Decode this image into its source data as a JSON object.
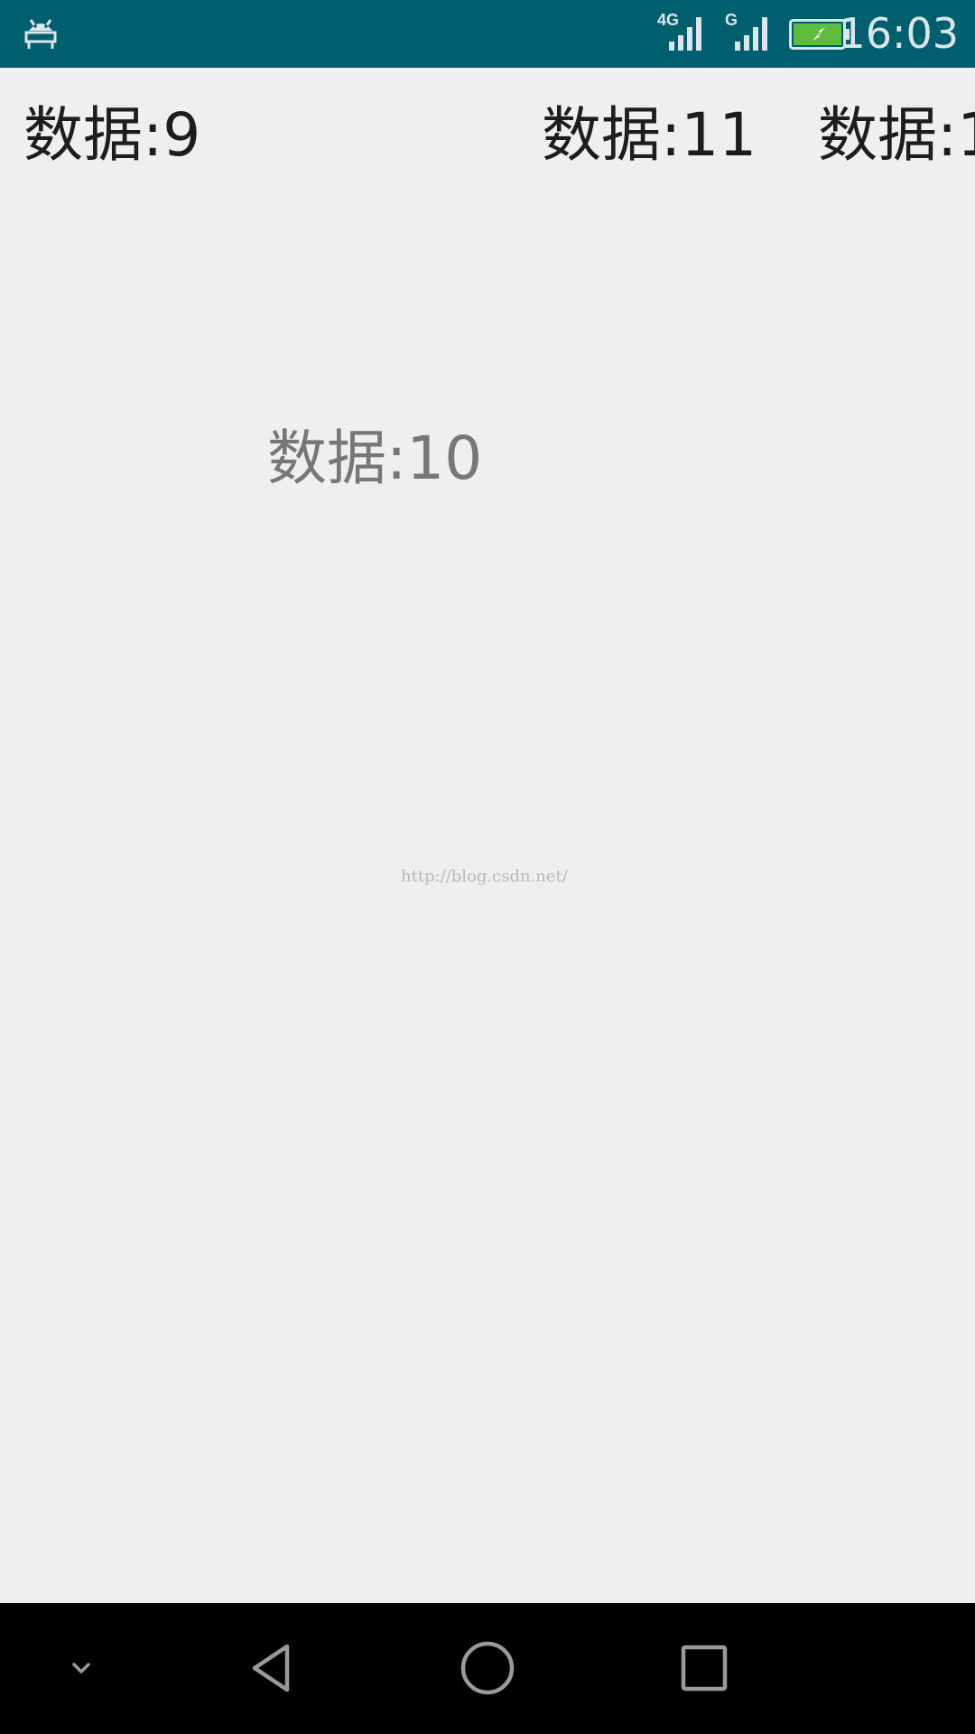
{
  "status_bar": {
    "network_1": "4G",
    "network_2": "G",
    "time": "16:03",
    "battery_icon": "battery-charging-icon",
    "notification_icon": "android-debug-icon",
    "colors": {
      "bar": "#005f6f",
      "battery_fill": "#5ebd3e"
    }
  },
  "carousel": {
    "items": [
      {
        "label": "数据:9"
      },
      {
        "label": "数据:10"
      },
      {
        "label": "数据:11"
      },
      {
        "label": "数据:1"
      }
    ]
  },
  "watermark": "http://blog.csdn.net/",
  "nav_bar": {
    "buttons": [
      {
        "name": "hide-nav-button",
        "icon": "chevron-down-icon"
      },
      {
        "name": "back-button",
        "icon": "back-triangle-icon"
      },
      {
        "name": "home-button",
        "icon": "home-circle-icon"
      },
      {
        "name": "recents-button",
        "icon": "recents-square-icon"
      }
    ]
  }
}
